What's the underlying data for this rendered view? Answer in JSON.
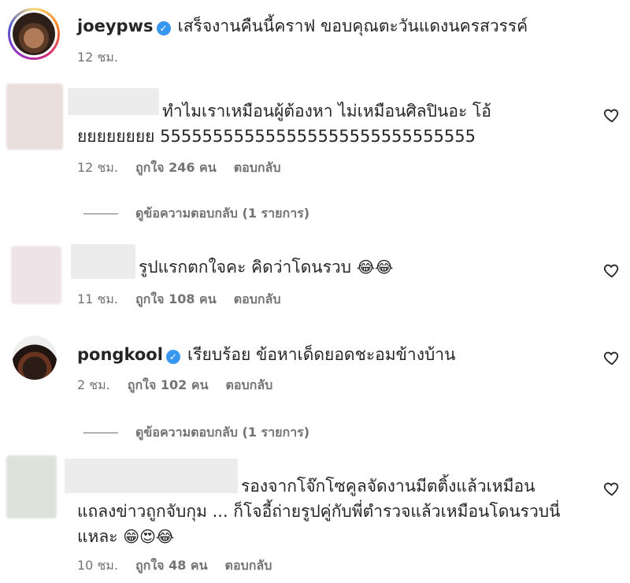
{
  "caption": {
    "username": "joeypws",
    "text": "เสร็จงานคืนนี้คราฟ ขอบคุณตะวันแดงนครสวรรค์",
    "time": "12 ชม."
  },
  "comments": [
    {
      "username": "",
      "text_line1": "ทำไมเราเหมือนผู้ต้องหา ไม่เหมือนศิลปินอะ โอ้",
      "text_line2": "ยยยยยยยย 555555555555555555555555555555",
      "time": "12 ชม.",
      "likes": "ถูกใจ 246 คน",
      "reply": "ตอบกลับ",
      "view_replies": "ดูข้อความตอบกลับ (1 รายการ)"
    },
    {
      "username": "",
      "text_line1": "รูปแรกตกใจคะ คิดว่าโดนรวบ",
      "emojis": "😂😂",
      "time": "11 ชม.",
      "likes": "ถูกใจ 108 คน",
      "reply": "ตอบกลับ"
    },
    {
      "username": "pongkool",
      "text_line1": "เรียบร้อย ข้อหาเด็ดยอดชะอมข้างบ้าน",
      "time": "2 ชม.",
      "likes": "ถูกใจ 102 คน",
      "reply": "ตอบกลับ",
      "view_replies": "ดูข้อความตอบกลับ (1 รายการ)"
    },
    {
      "username": "",
      "text_line1": "รองจากโจ๊กโซคูลจัดงานมีตติ้งแล้วเหมือน",
      "text_line2": "แถลงข่าวถูกจับกุม ... ก็โจอี้ถ่ายรูปคู่กับพี่ตำรวจแล้วเหมือนโดนรวบนี่",
      "text_line3": "แหละ",
      "emojis": "😁😍😂",
      "time": "10 ชม.",
      "likes": "ถูกใจ 48 คน",
      "reply": "ตอบกลับ"
    }
  ],
  "icons": {
    "heart": "heart-outline-icon",
    "verified": "verified-badge-icon"
  },
  "colors": {
    "verified": "#3897f0",
    "secondary_text": "#737373",
    "primary_text": "#262626"
  }
}
